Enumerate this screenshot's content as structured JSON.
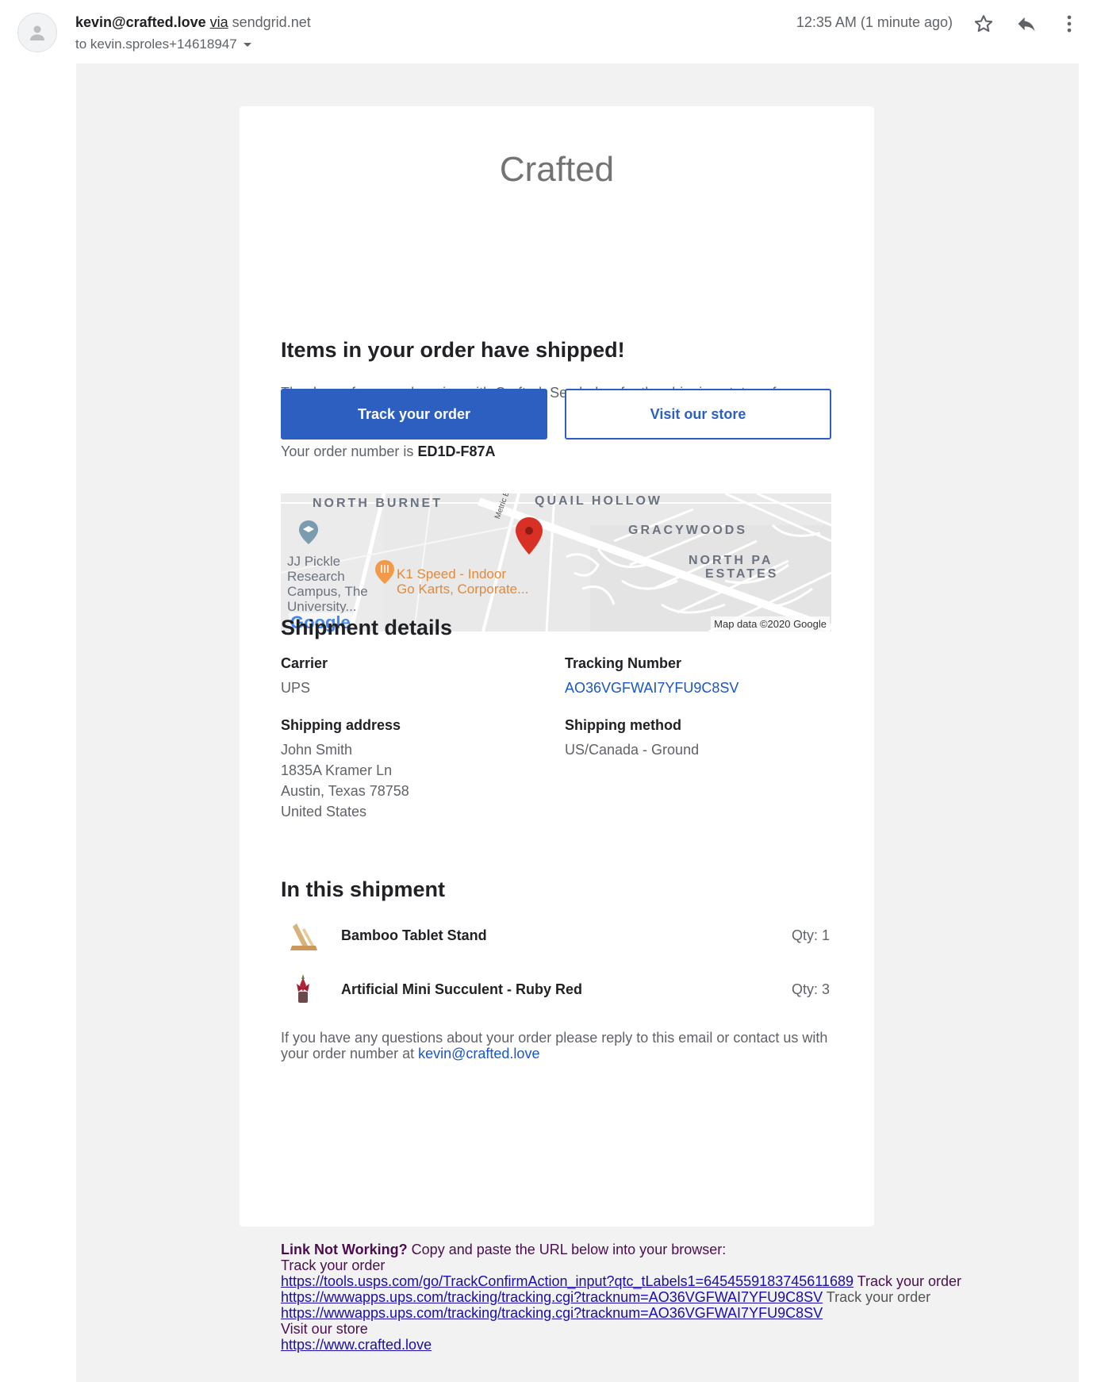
{
  "header": {
    "sender": "kevin@crafted.love",
    "via": "via",
    "relay": "sendgrid.net",
    "to": "to kevin.sproles+14618947",
    "timestamp": "12:35 AM (1 minute ago)"
  },
  "icons": [
    "person-icon",
    "star-icon",
    "reply-icon",
    "more-vert-icon",
    "caret-down-icon"
  ],
  "email": {
    "brand": "Crafted",
    "heading": "Items in your order have shipped!",
    "thanks": "Thank you for your shopping with Crafted. See below for the shipping status of your order.",
    "order_prefix": "Your order number is",
    "order_number": "ED1D-F87A",
    "track_button": "Track your order",
    "store_button": "Visit our store",
    "accent_color": "#2c5fbf",
    "map": {
      "labels": [
        "NORTH BURNET",
        "QUAIL HOLLOW",
        "GRACYWOODS",
        "NORTH PA",
        "ESTATES",
        "Metric Blvd"
      ],
      "poi1": [
        "JJ Pickle",
        "Research",
        "Campus, The",
        "University..."
      ],
      "poi2": [
        "K1 Speed - Indoor",
        "Go Karts, Corporate..."
      ],
      "logo": "Google",
      "attribution": "Map data ©2020 Google"
    },
    "shipment": {
      "heading": "Shipment details",
      "carrier_label": "Carrier",
      "carrier": "UPS",
      "tracking_label": "Tracking Number",
      "tracking": "AO36VGFWAI7YFU9C8SV",
      "address_label": "Shipping address",
      "address": [
        "John Smith",
        "1835A Kramer Ln",
        "Austin, Texas 78758",
        "United States"
      ],
      "method_label": "Shipping method",
      "method": "US/Canada - Ground"
    },
    "items": {
      "heading": "In this shipment",
      "list": [
        {
          "name": "Bamboo Tablet Stand",
          "qty": "Qty: 1"
        },
        {
          "name": "Artificial Mini Succulent - Ruby Red",
          "qty": "Qty: 3"
        }
      ]
    },
    "questions_text": "If you have any questions about your order please reply to this email or contact us with your order number at",
    "contact_email": "kevin@crafted.love"
  },
  "footer": {
    "title": "Link Not Working?",
    "instruction": "Copy and paste the URL below into your browser:",
    "track_label": "Track your order",
    "link1": "https://tools.usps.com/go/TrackConfirmAction_input?qtc_tLabels1=6454559183745611689",
    "after1": "Track your order",
    "link2": "https://wwwapps.ups.com/tracking/tracking.cgi?tracknum=AO36VGFWAI7YFU9C8SV",
    "after2": "Track your order",
    "link3": "https://wwwapps.ups.com/tracking/tracking.cgi?tracknum=AO36VGFWAI7YFU9C8SV",
    "store_label": "Visit our store",
    "link4": "https://www.crafted.love"
  }
}
